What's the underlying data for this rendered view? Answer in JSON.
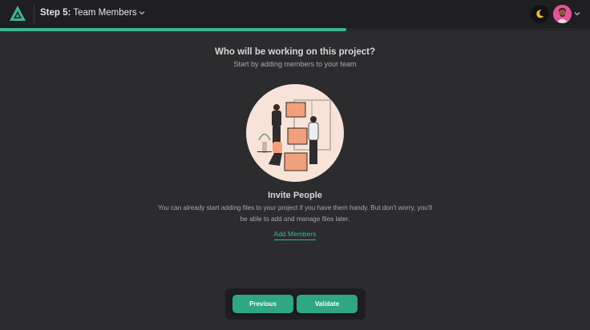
{
  "topbar": {
    "step_prefix": "Step 5:",
    "step_name": "Team Members"
  },
  "progress": {
    "fraction": 0.587
  },
  "main": {
    "heading": "Who will be working on this project?",
    "subheading": "Start by adding members to your team"
  },
  "invite": {
    "title": "Invite People",
    "description_line1": "You can already start adding files to your project if you have them handy. But don't worry, you'll",
    "description_line2": "be able to add and manage files later.",
    "add_members_label": "Add Members"
  },
  "footer": {
    "previous_label": "Previous",
    "validate_label": "Validate"
  },
  "colors": {
    "accent": "#3bb58b",
    "background": "#2c2c2e",
    "topbar": "#1f1f21"
  },
  "icons": [
    "logo-icon",
    "chevron-down-icon",
    "moon-icon",
    "avatar"
  ]
}
